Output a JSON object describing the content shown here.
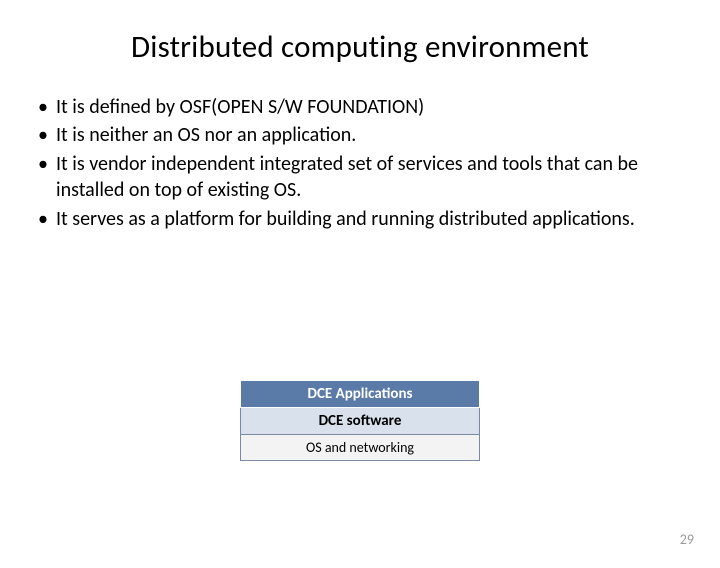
{
  "title": "Distributed computing environment",
  "bullets": [
    "It is defined by OSF(OPEN S/W FOUNDATION)",
    "It is neither an OS nor an application.",
    "It is vendor independent integrated set of services and tools that can be installed on top of existing OS.",
    "It  serves as a platform for building and running distributed applications."
  ],
  "stack": {
    "layer0": "DCE  Applications",
    "layer1": "DCE software",
    "layer2": "OS and networking"
  },
  "page_number": "29"
}
